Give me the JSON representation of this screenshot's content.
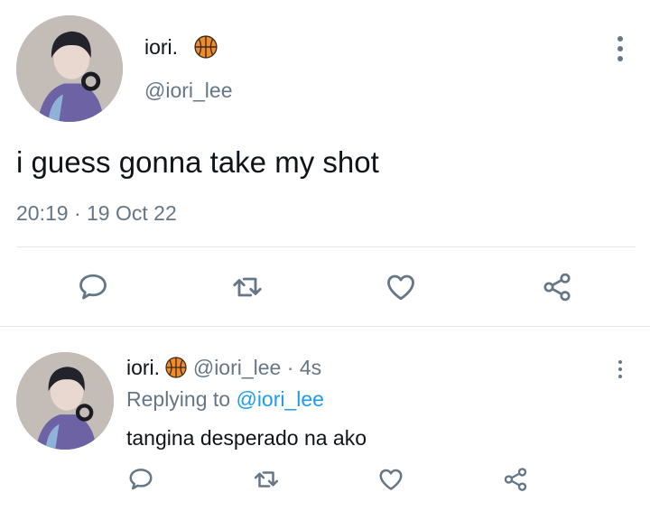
{
  "tweet": {
    "display_name": "iori.",
    "badge_icon": "basketball-icon",
    "handle": "@iori_lee",
    "text": "i guess gonna take my shot",
    "time": "20:19",
    "separator": "·",
    "date": "19 Oct 22"
  },
  "reply": {
    "display_name": "iori.",
    "badge_icon": "basketball-icon",
    "handle": "@iori_lee",
    "dot": "·",
    "age": "4s",
    "replying_prefix": "Replying to",
    "replying_handle": "@iori_lee",
    "text": "tangina desperado na ako"
  },
  "actions": [
    "reply-icon",
    "retweet-icon",
    "like-icon",
    "share-icon"
  ],
  "colors": {
    "text": "#0f1419",
    "muted": "#657786",
    "link": "#1d9bf0",
    "badge": "#f28c28"
  }
}
